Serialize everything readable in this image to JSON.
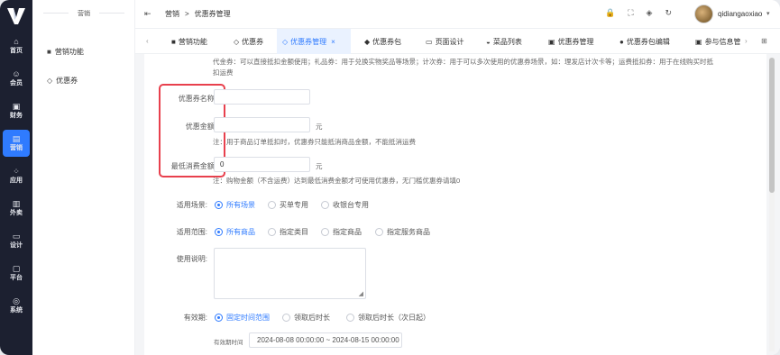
{
  "rail": {
    "items": [
      {
        "icon": "⌂",
        "label": "首页"
      },
      {
        "icon": "☺",
        "label": "会员"
      },
      {
        "icon": "▣",
        "label": "财务"
      },
      {
        "icon": "▤",
        "label": "营销"
      },
      {
        "icon": "⁘",
        "label": "应用"
      },
      {
        "icon": "▥",
        "label": "外卖"
      },
      {
        "icon": "▭",
        "label": "设计"
      },
      {
        "icon": "▢",
        "label": "平台"
      },
      {
        "icon": "◎",
        "label": "系统"
      }
    ]
  },
  "sidebar": {
    "title": "营销",
    "items": [
      {
        "icon": "■",
        "label": "营销功能"
      },
      {
        "icon": "◇",
        "label": "优惠券"
      }
    ]
  },
  "header": {
    "fold_icon": "⇤",
    "breadcrumb": [
      "营销",
      ">",
      "优惠券管理"
    ],
    "username": "qidiangaoxiao",
    "icons": [
      "🔒",
      "⛶",
      "◈",
      "↻"
    ]
  },
  "tabs": {
    "items": [
      {
        "icon": "■",
        "label": "营销功能"
      },
      {
        "icon": "◇",
        "label": "优惠券"
      },
      {
        "icon": "◇",
        "label": "优惠券管理",
        "close": "×"
      },
      {
        "icon": "◆",
        "label": "优惠券包"
      },
      {
        "icon": "▭",
        "label": "页面设计"
      },
      {
        "icon": "◒",
        "label": "菜品列表"
      },
      {
        "icon": "▣",
        "label": "优惠券管理"
      },
      {
        "icon": "●",
        "label": "优惠券包编辑"
      },
      {
        "icon": "▣",
        "label": "参与信息管"
      }
    ],
    "prev": "‹",
    "next": "›",
    "more": "⊞"
  },
  "form": {
    "type_note": "代金券：可以直接抵扣金额使用；礼品券：用于兑换实物奖品等场景；计次券：用于可以多次使用的优惠券场景，如：理发店计次卡等；运费抵扣券：用于在线购买时抵扣运费",
    "name_label": "优惠券名称:",
    "name_value": "",
    "amount_label": "优惠金额:",
    "amount_value": "",
    "amount_unit": "元",
    "amount_note": "注：用于商品订单抵扣时，优惠券只能抵消商品金额，不能抵消运费",
    "min_label": "最低消费金额:",
    "min_value": "0",
    "min_unit": "元",
    "min_note": "注：购物金额（不含运费）达到最低消费金额才可使用优惠券，无门槛优惠券请填0",
    "scene_label": "适用场景:",
    "scene_options": [
      "所有场景",
      "买单专用",
      "收银台专用"
    ],
    "range_label": "适用范围:",
    "range_options": [
      "所有商品",
      "指定类目",
      "指定商品",
      "指定服务商品"
    ],
    "usage_label": "使用说明:",
    "usage_value": "",
    "validity_label": "有效期:",
    "validity_options": [
      "固定时间范围",
      "领取后时长",
      "领取后时长（次日起）"
    ],
    "period_label": "有效期时间",
    "period_value": "2024-08-08 00:00:00 ~ 2024-08-15 00:00:00"
  },
  "colors": {
    "accent": "#2f7bff",
    "rail_bg": "#1c2030",
    "highlight_border": "#e8404d"
  }
}
